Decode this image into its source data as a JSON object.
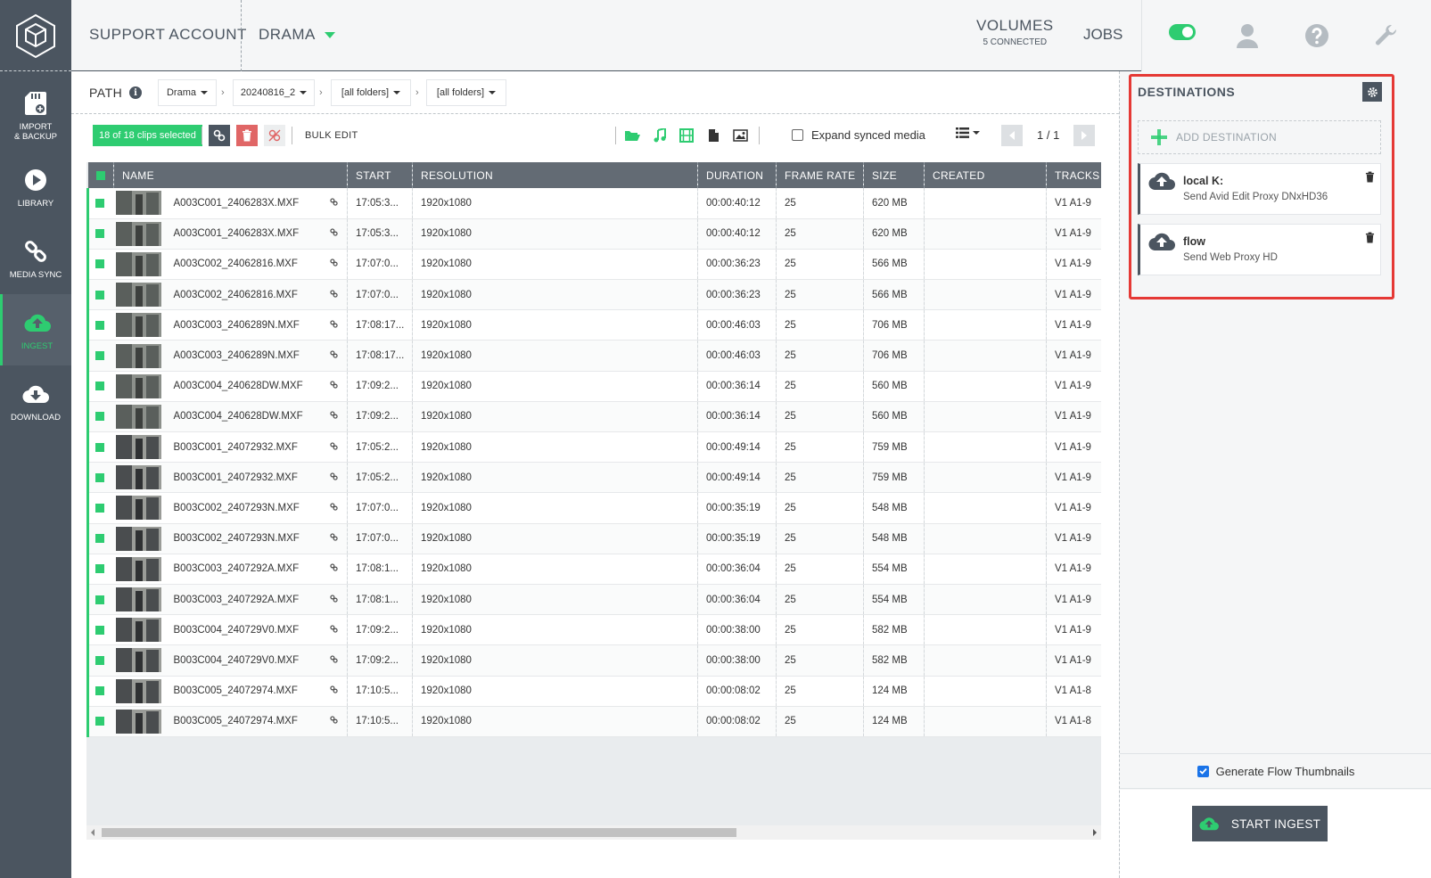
{
  "sidebar": {
    "items": [
      {
        "label": "IMPORT\n& BACKUP",
        "icon": "sd-card-icon"
      },
      {
        "label": "LIBRARY",
        "icon": "play-circle-icon"
      },
      {
        "label": "MEDIA SYNC",
        "icon": "link-icon"
      },
      {
        "label": "INGEST",
        "icon": "cloud-upload-icon"
      },
      {
        "label": "DOWNLOAD",
        "icon": "cloud-download-icon"
      }
    ],
    "active": "INGEST"
  },
  "topbar": {
    "account": "SUPPORT ACCOUNT",
    "project": "DRAMA",
    "volumes_label": "VOLUMES",
    "volumes_sub": "5 CONNECTED",
    "jobs": "JOBS"
  },
  "path": {
    "label": "PATH",
    "crumbs": [
      "Drama",
      "20240816_2",
      "[all folders]",
      "[all folders]"
    ]
  },
  "toolbar": {
    "selection": "18 of 18 clips selected",
    "bulk_edit": "BULK EDIT",
    "expand_synced": "Expand synced media",
    "page": "1 / 1"
  },
  "table": {
    "columns": [
      "NAME",
      "START",
      "RESOLUTION",
      "DURATION",
      "FRAME RATE",
      "SIZE",
      "CREATED",
      "TRACKS"
    ],
    "rows": [
      {
        "name": "A003C001_2406283X.MXF",
        "start": "17:05:3...",
        "res": "1920x1080",
        "dur": "00:00:40:12",
        "fps": "25",
        "size": "620 MB",
        "created": "",
        "tracks": "V1 A1-9"
      },
      {
        "name": "A003C001_2406283X.MXF",
        "start": "17:05:3...",
        "res": "1920x1080",
        "dur": "00:00:40:12",
        "fps": "25",
        "size": "620 MB",
        "created": "",
        "tracks": "V1 A1-9"
      },
      {
        "name": "A003C002_24062816.MXF",
        "start": "17:07:0...",
        "res": "1920x1080",
        "dur": "00:00:36:23",
        "fps": "25",
        "size": "566 MB",
        "created": "",
        "tracks": "V1 A1-9"
      },
      {
        "name": "A003C002_24062816.MXF",
        "start": "17:07:0...",
        "res": "1920x1080",
        "dur": "00:00:36:23",
        "fps": "25",
        "size": "566 MB",
        "created": "",
        "tracks": "V1 A1-9"
      },
      {
        "name": "A003C003_2406289N.MXF",
        "start": "17:08:17...",
        "res": "1920x1080",
        "dur": "00:00:46:03",
        "fps": "25",
        "size": "706 MB",
        "created": "",
        "tracks": "V1 A1-9"
      },
      {
        "name": "A003C003_2406289N.MXF",
        "start": "17:08:17...",
        "res": "1920x1080",
        "dur": "00:00:46:03",
        "fps": "25",
        "size": "706 MB",
        "created": "",
        "tracks": "V1 A1-9"
      },
      {
        "name": "A003C004_240628DW.MXF",
        "start": "17:09:2...",
        "res": "1920x1080",
        "dur": "00:00:36:14",
        "fps": "25",
        "size": "560 MB",
        "created": "",
        "tracks": "V1 A1-9"
      },
      {
        "name": "A003C004_240628DW.MXF",
        "start": "17:09:2...",
        "res": "1920x1080",
        "dur": "00:00:36:14",
        "fps": "25",
        "size": "560 MB",
        "created": "",
        "tracks": "V1 A1-9"
      },
      {
        "name": "B003C001_24072932.MXF",
        "start": "17:05:2...",
        "res": "1920x1080",
        "dur": "00:00:49:14",
        "fps": "25",
        "size": "759 MB",
        "created": "",
        "tracks": "V1 A1-9"
      },
      {
        "name": "B003C001_24072932.MXF",
        "start": "17:05:2...",
        "res": "1920x1080",
        "dur": "00:00:49:14",
        "fps": "25",
        "size": "759 MB",
        "created": "",
        "tracks": "V1 A1-9"
      },
      {
        "name": "B003C002_2407293N.MXF",
        "start": "17:07:0...",
        "res": "1920x1080",
        "dur": "00:00:35:19",
        "fps": "25",
        "size": "548 MB",
        "created": "",
        "tracks": "V1 A1-9"
      },
      {
        "name": "B003C002_2407293N.MXF",
        "start": "17:07:0...",
        "res": "1920x1080",
        "dur": "00:00:35:19",
        "fps": "25",
        "size": "548 MB",
        "created": "",
        "tracks": "V1 A1-9"
      },
      {
        "name": "B003C003_2407292A.MXF",
        "start": "17:08:1...",
        "res": "1920x1080",
        "dur": "00:00:36:04",
        "fps": "25",
        "size": "554 MB",
        "created": "",
        "tracks": "V1 A1-9"
      },
      {
        "name": "B003C003_2407292A.MXF",
        "start": "17:08:1...",
        "res": "1920x1080",
        "dur": "00:00:36:04",
        "fps": "25",
        "size": "554 MB",
        "created": "",
        "tracks": "V1 A1-9"
      },
      {
        "name": "B003C004_240729V0.MXF",
        "start": "17:09:2...",
        "res": "1920x1080",
        "dur": "00:00:38:00",
        "fps": "25",
        "size": "582 MB",
        "created": "",
        "tracks": "V1 A1-9"
      },
      {
        "name": "B003C004_240729V0.MXF",
        "start": "17:09:2...",
        "res": "1920x1080",
        "dur": "00:00:38:00",
        "fps": "25",
        "size": "582 MB",
        "created": "",
        "tracks": "V1 A1-9"
      },
      {
        "name": "B003C005_24072974.MXF",
        "start": "17:10:5...",
        "res": "1920x1080",
        "dur": "00:00:08:02",
        "fps": "25",
        "size": "124 MB",
        "created": "",
        "tracks": "V1 A1-8"
      },
      {
        "name": "B003C005_24072974.MXF",
        "start": "17:10:5...",
        "res": "1920x1080",
        "dur": "00:00:08:02",
        "fps": "25",
        "size": "124 MB",
        "created": "",
        "tracks": "V1 A1-8"
      }
    ]
  },
  "destinations": {
    "title": "DESTINATIONS",
    "add_label": "ADD DESTINATION",
    "items": [
      {
        "name": "local K:",
        "desc": "Send Avid Edit Proxy DNxHD36"
      },
      {
        "name": "flow",
        "desc": "Send Web Proxy HD"
      }
    ]
  },
  "footer": {
    "generate_thumbs": "Generate Flow Thumbnails",
    "start_ingest": "START INGEST"
  },
  "colors": {
    "accent": "#2ecc71",
    "sidebar": "#4b5560",
    "highlight": "#e53935"
  }
}
